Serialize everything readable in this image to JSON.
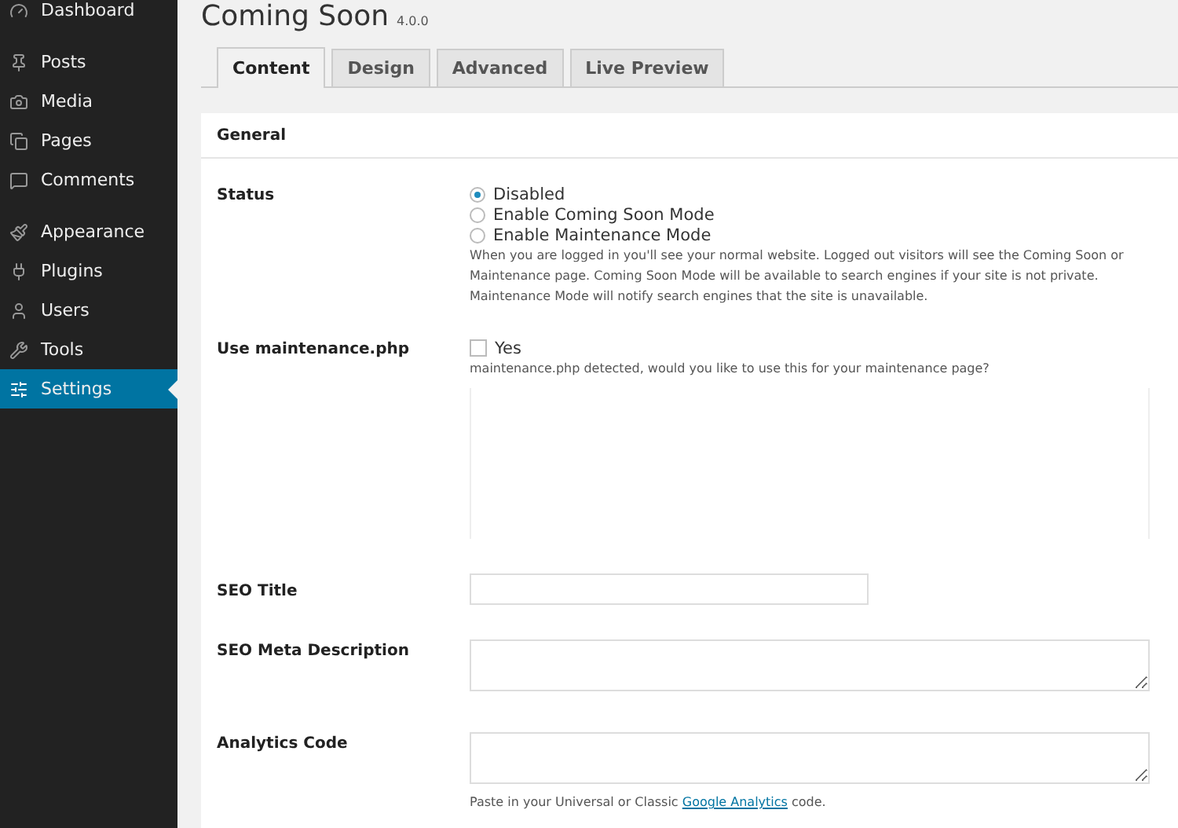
{
  "sidebar": {
    "groups": [
      [
        {
          "label": "Dashboard",
          "selected": false
        }
      ],
      [
        {
          "label": "Posts",
          "selected": false
        },
        {
          "label": "Media",
          "selected": false
        },
        {
          "label": "Pages",
          "selected": false
        },
        {
          "label": "Comments",
          "selected": false
        }
      ],
      [
        {
          "label": "Appearance",
          "selected": false
        },
        {
          "label": "Plugins",
          "selected": false
        },
        {
          "label": "Users",
          "selected": false
        },
        {
          "label": "Tools",
          "selected": false
        },
        {
          "label": "Settings",
          "selected": true
        }
      ]
    ]
  },
  "page": {
    "title": "Coming Soon",
    "version": "4.0.0"
  },
  "tabs": [
    {
      "label": "Content",
      "selected": true
    },
    {
      "label": "Design",
      "selected": false
    },
    {
      "label": "Advanced",
      "selected": false
    },
    {
      "label": "Live Preview",
      "selected": false
    }
  ],
  "section": {
    "title": "General"
  },
  "status": {
    "label": "Status",
    "options": [
      {
        "label": "Disabled",
        "selected": true
      },
      {
        "label": "Enable Coming Soon Mode",
        "selected": false
      },
      {
        "label": "Enable Maintenance Mode",
        "selected": false
      }
    ],
    "help": "When you are logged in you'll see your normal website. Logged out visitors will see the Coming Soon or Maintenance page. Coming Soon Mode will be available to search engines if your site is not private. Maintenance Mode will notify search engines that the site is unavailable."
  },
  "maintenance": {
    "label": "Use maintenance.php",
    "option": "Yes",
    "checked": false,
    "help": "maintenance.php detected, would you like to use this for your maintenance page?"
  },
  "seo_title": {
    "label": "SEO Title"
  },
  "seo_description": {
    "label": "SEO Meta Description"
  },
  "analytics": {
    "label": "Analytics Code",
    "help_before": "Paste in your Universal or Classic",
    "help_link": "Google Analytics",
    "help_after": "code."
  }
}
